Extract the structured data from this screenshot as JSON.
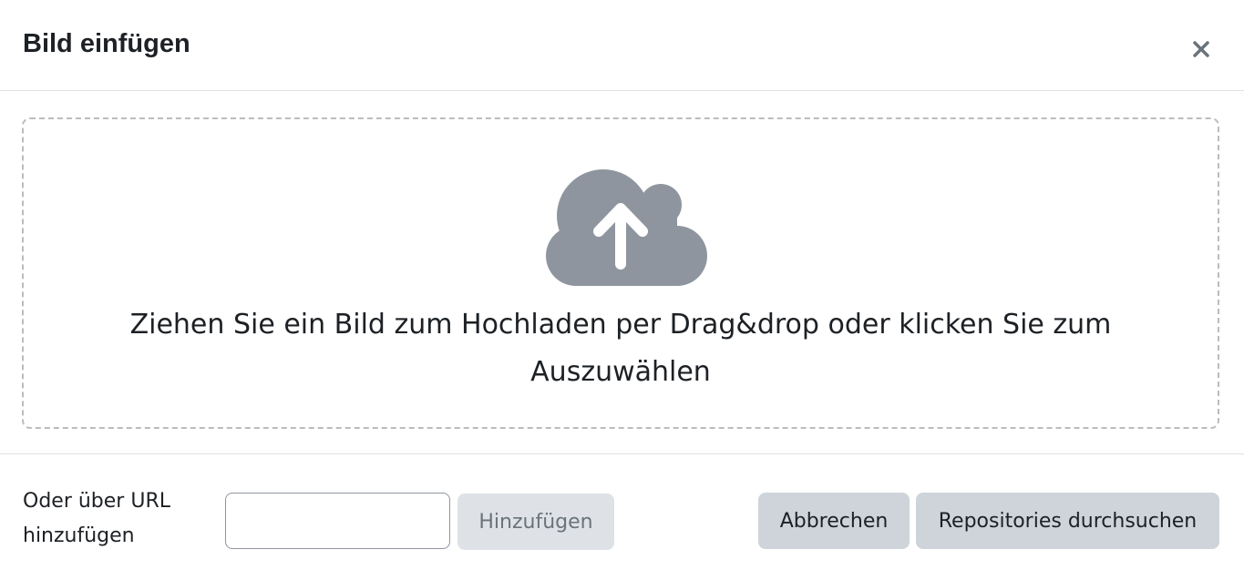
{
  "dialog": {
    "title": "Bild einfügen",
    "close_label": "×"
  },
  "dropzone": {
    "icon": "cloud-upload-icon",
    "text": "Ziehen Sie ein Bild zum Hochladen per Drag&drop oder klicken Sie zum Auszuwählen"
  },
  "footer": {
    "url_label": "Oder über URL hinzufügen",
    "url_input_value": "",
    "add_button": "Hinzufügen",
    "cancel_button": "Abbrechen",
    "browse_button": "Repositories durchsuchen"
  },
  "colors": {
    "icon": "#8f959e",
    "button_secondary": "#ced4da",
    "button_disabled": "#dee2e6",
    "dropzone_border": "#bcbcbc"
  }
}
